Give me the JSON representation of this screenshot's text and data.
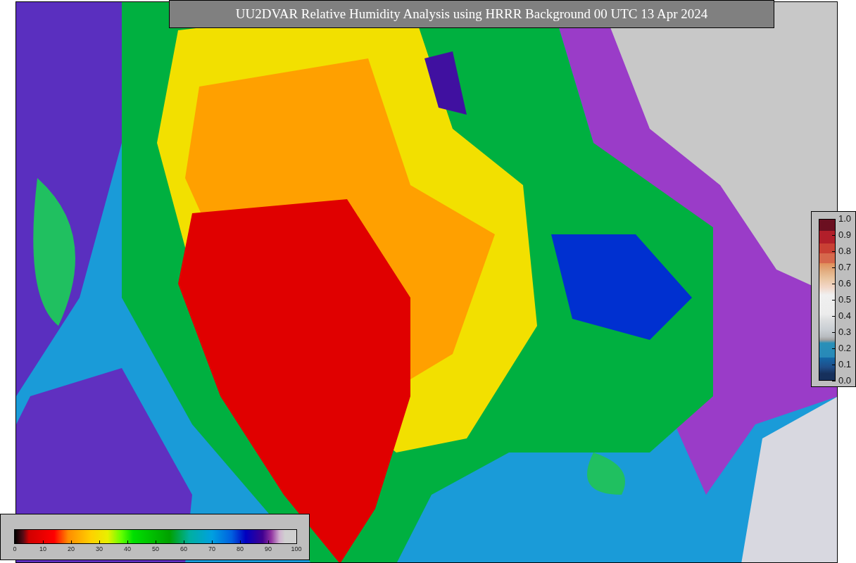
{
  "title": "UU2DVAR Relative Humidity Analysis using HRRR Background 00 UTC 13 Apr 2024",
  "humidity_colorbar": {
    "ticks": [
      "0",
      "10",
      "20",
      "30",
      "40",
      "50",
      "60",
      "70",
      "80",
      "90",
      "100"
    ]
  },
  "fraction_colorbar": {
    "ticks": [
      "1.0",
      "0.9",
      "0.8",
      "0.7",
      "0.6",
      "0.5",
      "0.4",
      "0.3",
      "0.2",
      "0.1",
      "0.0"
    ]
  }
}
